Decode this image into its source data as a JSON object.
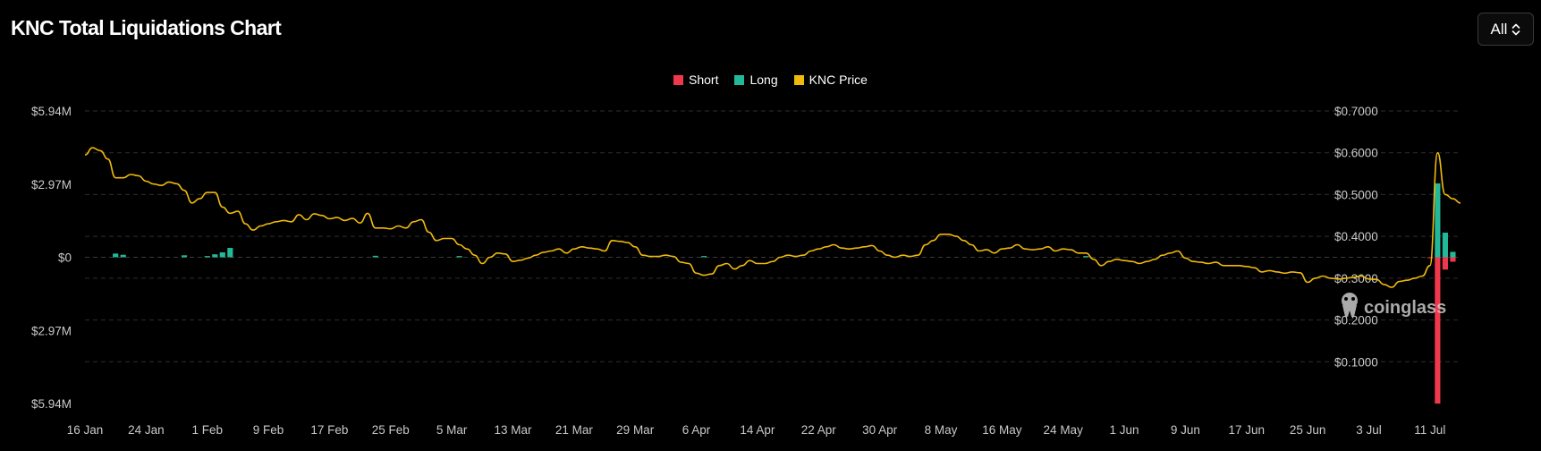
{
  "title": "KNC Total Liquidations Chart",
  "range_select": {
    "value": "All",
    "icon": "chevron-updown-icon"
  },
  "legend": [
    {
      "label": "Short",
      "color": "#f0384d"
    },
    {
      "label": "Long",
      "color": "#23b899"
    },
    {
      "label": "KNC Price",
      "color": "#f0b90b"
    }
  ],
  "watermark": {
    "text": "coinglass",
    "icon": "coinglass-logo-icon"
  },
  "chart_data": {
    "type": "bar+line",
    "x_ticks": [
      "16 Jan",
      "24 Jan",
      "1 Feb",
      "9 Feb",
      "17 Feb",
      "25 Feb",
      "5 Mar",
      "13 Mar",
      "21 Mar",
      "29 Mar",
      "6 Apr",
      "14 Apr",
      "22 Apr",
      "30 Apr",
      "8 May",
      "16 May",
      "24 May",
      "1 Jun",
      "9 Jun",
      "17 Jun",
      "25 Jun",
      "3 Jul",
      "11 Jul"
    ],
    "left_axis": {
      "ticks": [
        "$5.94M",
        "$2.97M",
        "$0",
        "$2.97M",
        "$5.94M"
      ],
      "ylim": [
        -5.94,
        5.94
      ],
      "unit": "M USD"
    },
    "right_axis": {
      "ticks": [
        "$0.7000",
        "$0.6000",
        "$0.5000",
        "$0.4000",
        "$0.3000",
        "$0.2000",
        "$0.1000"
      ],
      "ylim": [
        0,
        0.7
      ]
    },
    "long_bars": [
      {
        "date": "2024-01-20",
        "value": 0.15
      },
      {
        "date": "2024-01-21",
        "value": 0.1
      },
      {
        "date": "2024-01-29",
        "value": 0.08
      },
      {
        "date": "2024-02-01",
        "value": 0.05
      },
      {
        "date": "2024-02-02",
        "value": 0.12
      },
      {
        "date": "2024-02-03",
        "value": 0.2
      },
      {
        "date": "2024-02-04",
        "value": 0.38
      },
      {
        "date": "2024-02-23",
        "value": 0.06
      },
      {
        "date": "2024-03-05",
        "value": 0.05
      },
      {
        "date": "2024-04-06",
        "value": 0.05
      },
      {
        "date": "2024-05-26",
        "value": 0.05
      },
      {
        "date": "2024-07-11",
        "value": 3.0
      },
      {
        "date": "2024-07-12",
        "value": 1.0
      },
      {
        "date": "2024-07-13",
        "value": 0.22
      }
    ],
    "short_bars": [
      {
        "date": "2024-07-10",
        "value": -0.03
      },
      {
        "date": "2024-07-11",
        "value": -5.94
      },
      {
        "date": "2024-07-12",
        "value": -0.5
      },
      {
        "date": "2024-07-13",
        "value": -0.18
      }
    ],
    "price": [
      [
        "2024-01-16",
        0.595
      ],
      [
        "2024-01-17",
        0.612
      ],
      [
        "2024-01-18",
        0.605
      ],
      [
        "2024-01-19",
        0.585
      ],
      [
        "2024-01-20",
        0.54
      ],
      [
        "2024-01-21",
        0.54
      ],
      [
        "2024-01-22",
        0.548
      ],
      [
        "2024-01-23",
        0.545
      ],
      [
        "2024-01-24",
        0.532
      ],
      [
        "2024-01-25",
        0.525
      ],
      [
        "2024-01-26",
        0.522
      ],
      [
        "2024-01-27",
        0.53
      ],
      [
        "2024-01-28",
        0.526
      ],
      [
        "2024-01-29",
        0.51
      ],
      [
        "2024-01-30",
        0.48
      ],
      [
        "2024-01-31",
        0.49
      ],
      [
        "2024-02-01",
        0.505
      ],
      [
        "2024-02-02",
        0.505
      ],
      [
        "2024-02-03",
        0.47
      ],
      [
        "2024-02-04",
        0.455
      ],
      [
        "2024-02-05",
        0.46
      ],
      [
        "2024-02-06",
        0.43
      ],
      [
        "2024-02-07",
        0.415
      ],
      [
        "2024-02-08",
        0.425
      ],
      [
        "2024-02-09",
        0.43
      ],
      [
        "2024-02-10",
        0.435
      ],
      [
        "2024-02-11",
        0.438
      ],
      [
        "2024-02-12",
        0.435
      ],
      [
        "2024-02-13",
        0.452
      ],
      [
        "2024-02-14",
        0.44
      ],
      [
        "2024-02-15",
        0.454
      ],
      [
        "2024-02-16",
        0.45
      ],
      [
        "2024-02-17",
        0.442
      ],
      [
        "2024-02-18",
        0.445
      ],
      [
        "2024-02-19",
        0.438
      ],
      [
        "2024-02-20",
        0.443
      ],
      [
        "2024-02-21",
        0.432
      ],
      [
        "2024-02-22",
        0.455
      ],
      [
        "2024-02-23",
        0.42
      ],
      [
        "2024-02-24",
        0.42
      ],
      [
        "2024-02-25",
        0.418
      ],
      [
        "2024-02-26",
        0.425
      ],
      [
        "2024-02-27",
        0.42
      ],
      [
        "2024-02-28",
        0.435
      ],
      [
        "2024-02-29",
        0.44
      ],
      [
        "2024-03-01",
        0.41
      ],
      [
        "2024-03-02",
        0.39
      ],
      [
        "2024-03-03",
        0.395
      ],
      [
        "2024-03-04",
        0.395
      ],
      [
        "2024-03-05",
        0.38
      ],
      [
        "2024-03-06",
        0.37
      ],
      [
        "2024-03-07",
        0.355
      ],
      [
        "2024-03-08",
        0.335
      ],
      [
        "2024-03-09",
        0.35
      ],
      [
        "2024-03-10",
        0.36
      ],
      [
        "2024-03-11",
        0.358
      ],
      [
        "2024-03-12",
        0.34
      ],
      [
        "2024-03-13",
        0.343
      ],
      [
        "2024-03-14",
        0.348
      ],
      [
        "2024-03-15",
        0.355
      ],
      [
        "2024-03-16",
        0.362
      ],
      [
        "2024-03-17",
        0.365
      ],
      [
        "2024-03-18",
        0.37
      ],
      [
        "2024-03-19",
        0.36
      ],
      [
        "2024-03-20",
        0.37
      ],
      [
        "2024-03-21",
        0.375
      ],
      [
        "2024-03-22",
        0.372
      ],
      [
        "2024-03-23",
        0.37
      ],
      [
        "2024-03-24",
        0.365
      ],
      [
        "2024-03-25",
        0.39
      ],
      [
        "2024-03-26",
        0.388
      ],
      [
        "2024-03-27",
        0.385
      ],
      [
        "2024-03-28",
        0.375
      ],
      [
        "2024-03-29",
        0.355
      ],
      [
        "2024-03-30",
        0.352
      ],
      [
        "2024-03-31",
        0.352
      ],
      [
        "2024-04-01",
        0.355
      ],
      [
        "2024-04-02",
        0.352
      ],
      [
        "2024-04-03",
        0.338
      ],
      [
        "2024-04-04",
        0.335
      ],
      [
        "2024-04-05",
        0.312
      ],
      [
        "2024-04-06",
        0.307
      ],
      [
        "2024-04-07",
        0.31
      ],
      [
        "2024-04-08",
        0.33
      ],
      [
        "2024-04-09",
        0.335
      ],
      [
        "2024-04-10",
        0.322
      ],
      [
        "2024-04-11",
        0.33
      ],
      [
        "2024-04-12",
        0.342
      ],
      [
        "2024-04-13",
        0.335
      ],
      [
        "2024-04-14",
        0.335
      ],
      [
        "2024-04-15",
        0.34
      ],
      [
        "2024-04-16",
        0.35
      ],
      [
        "2024-04-17",
        0.355
      ],
      [
        "2024-04-18",
        0.352
      ],
      [
        "2024-04-19",
        0.355
      ],
      [
        "2024-04-20",
        0.365
      ],
      [
        "2024-04-21",
        0.37
      ],
      [
        "2024-04-22",
        0.375
      ],
      [
        "2024-04-23",
        0.38
      ],
      [
        "2024-04-24",
        0.372
      ],
      [
        "2024-04-25",
        0.37
      ],
      [
        "2024-04-26",
        0.372
      ],
      [
        "2024-04-27",
        0.375
      ],
      [
        "2024-04-28",
        0.378
      ],
      [
        "2024-04-29",
        0.365
      ],
      [
        "2024-04-30",
        0.355
      ],
      [
        "2024-05-01",
        0.35
      ],
      [
        "2024-05-02",
        0.355
      ],
      [
        "2024-05-03",
        0.352
      ],
      [
        "2024-05-04",
        0.355
      ],
      [
        "2024-05-05",
        0.38
      ],
      [
        "2024-05-06",
        0.39
      ],
      [
        "2024-05-07",
        0.405
      ],
      [
        "2024-05-08",
        0.405
      ],
      [
        "2024-05-09",
        0.4
      ],
      [
        "2024-05-10",
        0.39
      ],
      [
        "2024-05-11",
        0.38
      ],
      [
        "2024-05-12",
        0.365
      ],
      [
        "2024-05-13",
        0.368
      ],
      [
        "2024-05-14",
        0.36
      ],
      [
        "2024-05-15",
        0.37
      ],
      [
        "2024-05-16",
        0.372
      ],
      [
        "2024-05-17",
        0.38
      ],
      [
        "2024-05-18",
        0.37
      ],
      [
        "2024-05-19",
        0.368
      ],
      [
        "2024-05-20",
        0.37
      ],
      [
        "2024-05-21",
        0.375
      ],
      [
        "2024-05-22",
        0.365
      ],
      [
        "2024-05-23",
        0.37
      ],
      [
        "2024-05-24",
        0.368
      ],
      [
        "2024-05-25",
        0.36
      ],
      [
        "2024-05-26",
        0.36
      ],
      [
        "2024-05-27",
        0.345
      ],
      [
        "2024-05-28",
        0.33
      ],
      [
        "2024-05-29",
        0.34
      ],
      [
        "2024-05-30",
        0.345
      ],
      [
        "2024-05-31",
        0.342
      ],
      [
        "2024-06-01",
        0.34
      ],
      [
        "2024-06-02",
        0.335
      ],
      [
        "2024-06-03",
        0.34
      ],
      [
        "2024-06-04",
        0.345
      ],
      [
        "2024-06-05",
        0.355
      ],
      [
        "2024-06-06",
        0.36
      ],
      [
        "2024-06-07",
        0.365
      ],
      [
        "2024-06-08",
        0.348
      ],
      [
        "2024-06-09",
        0.34
      ],
      [
        "2024-06-10",
        0.338
      ],
      [
        "2024-06-11",
        0.335
      ],
      [
        "2024-06-12",
        0.338
      ],
      [
        "2024-06-13",
        0.33
      ],
      [
        "2024-06-14",
        0.33
      ],
      [
        "2024-06-15",
        0.33
      ],
      [
        "2024-06-16",
        0.328
      ],
      [
        "2024-06-17",
        0.325
      ],
      [
        "2024-06-18",
        0.315
      ],
      [
        "2024-06-19",
        0.318
      ],
      [
        "2024-06-20",
        0.315
      ],
      [
        "2024-06-21",
        0.312
      ],
      [
        "2024-06-22",
        0.315
      ],
      [
        "2024-06-23",
        0.313
      ],
      [
        "2024-06-24",
        0.29
      ],
      [
        "2024-06-25",
        0.3
      ],
      [
        "2024-06-26",
        0.305
      ],
      [
        "2024-06-27",
        0.3
      ],
      [
        "2024-06-28",
        0.298
      ],
      [
        "2024-06-29",
        0.3
      ],
      [
        "2024-06-30",
        0.302
      ],
      [
        "2024-07-01",
        0.305
      ],
      [
        "2024-07-02",
        0.298
      ],
      [
        "2024-07-03",
        0.297
      ],
      [
        "2024-07-04",
        0.285
      ],
      [
        "2024-07-05",
        0.278
      ],
      [
        "2024-07-06",
        0.292
      ],
      [
        "2024-07-07",
        0.295
      ],
      [
        "2024-07-08",
        0.3
      ],
      [
        "2024-07-09",
        0.305
      ],
      [
        "2024-07-10",
        0.33
      ],
      [
        "2024-07-11",
        0.6
      ],
      [
        "2024-07-12",
        0.5
      ],
      [
        "2024-07-13",
        0.49
      ],
      [
        "2024-07-14",
        0.48
      ]
    ]
  }
}
